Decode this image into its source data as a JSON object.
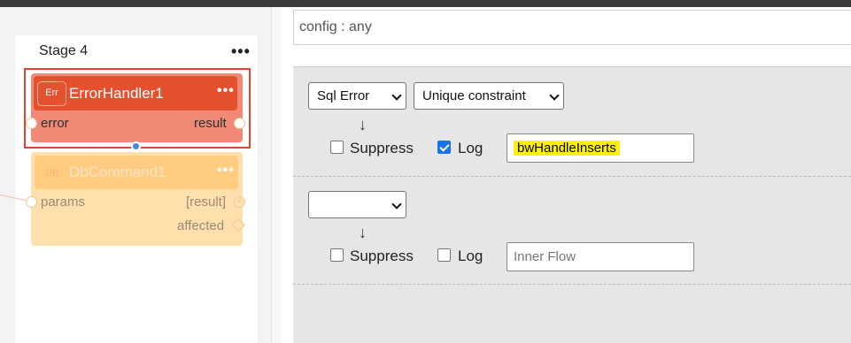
{
  "stage": {
    "title": "Stage 4",
    "menu": "•••"
  },
  "nodes": {
    "error_handler": {
      "badge": "Err",
      "name": "ErrorHandler1",
      "menu": "•••",
      "input_port": "error",
      "output_port": "result"
    },
    "db_command": {
      "badge": "DB",
      "name": "DbCommand1",
      "menu": "•••",
      "input_port": "params",
      "output_ports": [
        "[result]",
        "affected"
      ]
    }
  },
  "panel": {
    "config_label": "config : any",
    "rules": [
      {
        "error_type": "Sql Error",
        "error_subtype": "Unique constraint",
        "arrow": "↓",
        "suppress_label": "Suppress",
        "suppress_checked": false,
        "log_label": "Log",
        "log_checked": true,
        "flow_value": "bwHandleInserts",
        "flow_placeholder": "Inner Flow"
      },
      {
        "error_type": "",
        "arrow": "↓",
        "suppress_label": "Suppress",
        "suppress_checked": false,
        "log_label": "Log",
        "log_checked": false,
        "flow_value": "",
        "flow_placeholder": "Inner Flow"
      }
    ]
  },
  "colors": {
    "error_header": "#e5512f",
    "error_body": "#f08a76",
    "selection_border": "#e0432f",
    "db_header": "#ffcc80",
    "db_body": "#ffe0ad",
    "checkbox_checked": "#1a73e8",
    "highlight": "#fff200"
  }
}
